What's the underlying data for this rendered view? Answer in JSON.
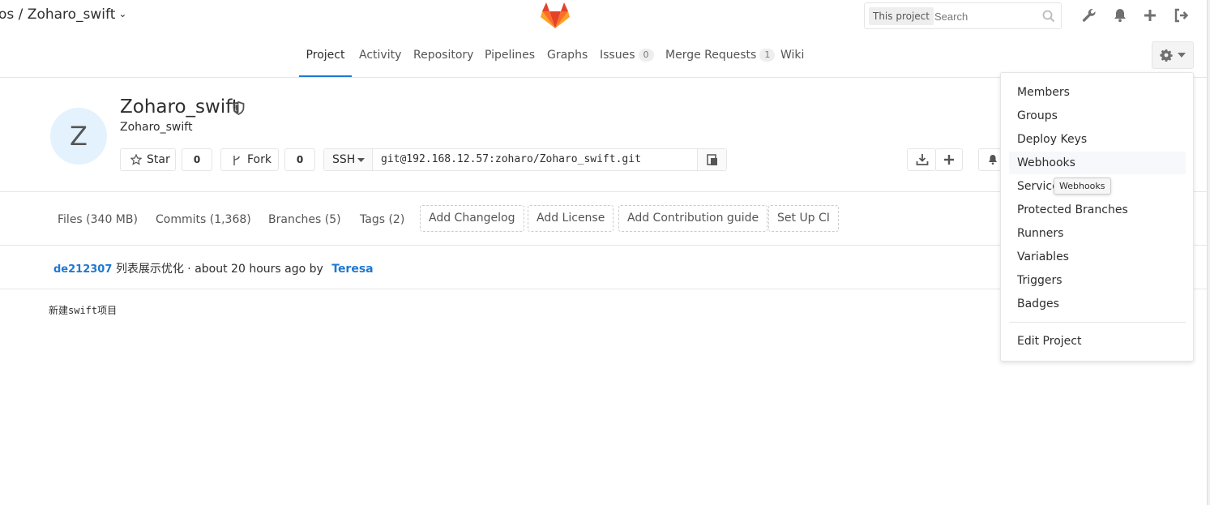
{
  "header": {
    "breadcrumb": "os / Zoharo_swift",
    "search_scope": "This project",
    "search_placeholder": "Search"
  },
  "nav": {
    "tabs": [
      {
        "label": "Project"
      },
      {
        "label": "Activity"
      },
      {
        "label": "Repository"
      },
      {
        "label": "Pipelines"
      },
      {
        "label": "Graphs"
      },
      {
        "label": "Issues",
        "count": "0"
      },
      {
        "label": "Merge Requests",
        "count": "1"
      },
      {
        "label": "Wiki"
      }
    ]
  },
  "project": {
    "avatar_letter": "Z",
    "name": "Zoharo_swift",
    "description": "Zoharo_swift",
    "star_label": "Star",
    "star_count": "0",
    "fork_label": "Fork",
    "fork_count": "0",
    "protocol": "SSH",
    "clone_url": "git@192.168.12.57:zoharo/Zoharo_swift.git"
  },
  "stats": {
    "files": "Files (340 MB)",
    "commits": "Commits (1,368)",
    "branches": "Branches (5)",
    "tags": "Tags (2)",
    "add_changelog": "Add Changelog",
    "add_license": "Add License",
    "add_contribution": "Add Contribution guide",
    "setup_ci": "Set Up CI"
  },
  "commit": {
    "sha": "de212307",
    "message": "列表展示优化 · about 20 hours ago by",
    "author": "Teresa"
  },
  "readme": {
    "text": "新建swift项目"
  },
  "settings_menu": {
    "items": [
      "Members",
      "Groups",
      "Deploy Keys",
      "Webhooks",
      "Service",
      "Protected Branches",
      "Runners",
      "Variables",
      "Triggers",
      "Badges"
    ],
    "edit_project": "Edit Project",
    "hovered_item": "Webhooks",
    "tooltip": "Webhooks"
  },
  "colors": {
    "accent": "#1f78d1",
    "logo_orange": "#fc6d26",
    "logo_dark": "#e24329",
    "logo_light": "#fca326"
  }
}
